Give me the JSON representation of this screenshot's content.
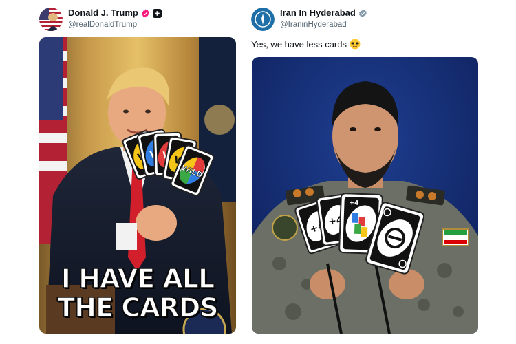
{
  "posts": [
    {
      "display_name": "Donald J. Trump",
      "handle": "@realDonaldTrump",
      "verified_badge_color": "#f91880",
      "has_follow_plus_icon": true,
      "media": {
        "caption_line1": "I HAVE ALL",
        "caption_line2": "THE CARDS",
        "card_labels": [
          "W",
          "W",
          "W",
          "W",
          "WILD"
        ]
      }
    },
    {
      "display_name": "Iran In Hyderabad",
      "handle": "@IraninHyderabad",
      "verified_badge_color": "#829aab",
      "text": "Yes, we have less cards",
      "emoji": "smiling-face-with-sunglasses",
      "media": {
        "card_labels": [
          "+4",
          "+4",
          "+4"
        ]
      }
    }
  ],
  "colors": {
    "background": "#ffffff",
    "text_primary": "#0f1419",
    "text_secondary": "#536471"
  }
}
